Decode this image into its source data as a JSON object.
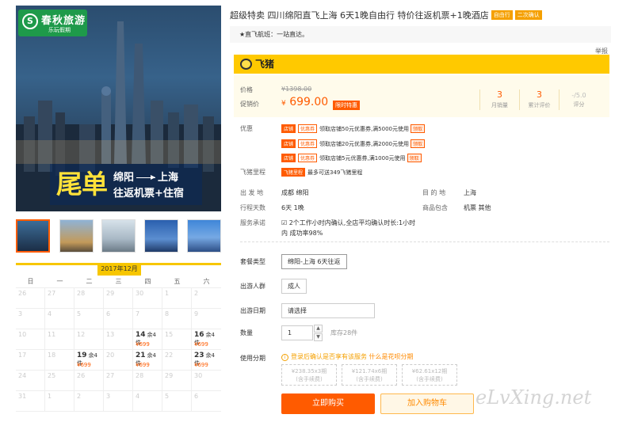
{
  "hero": {
    "logo_mark": "S",
    "logo_name": "春秋旅游",
    "logo_sub": "乐玩假期",
    "banner_big": "尾单",
    "banner_from": "绵阳",
    "banner_to": "上海",
    "banner_line2": "往返机票+住宿"
  },
  "product": {
    "title": "超级特卖 四川绵阳直飞上海 6天1晚自由行 特价往返机票+1晚酒店",
    "tags": [
      "自由行",
      "二次确认"
    ],
    "direct_flight_note": "★直飞航班：一站直达。",
    "report_link": "举报"
  },
  "brand": {
    "name": "飞猪"
  },
  "pricing": {
    "original_label": "价格",
    "original_price": "¥1398.00",
    "promo_label": "促销价",
    "currency": "¥",
    "promo_price": "699.00",
    "badge": "限时特惠",
    "stats": [
      {
        "value": "3",
        "label": "月销量"
      },
      {
        "value": "3",
        "label": "累计评价"
      },
      {
        "value": "-/5.0",
        "label": "评分"
      }
    ]
  },
  "promotions": {
    "label": "优惠",
    "items": [
      {
        "tag1": "店铺",
        "tag2": "优惠券",
        "text": "领取店铺50元优惠券,满5000元使用",
        "action": "领取"
      },
      {
        "tag1": "店铺",
        "tag2": "优惠券",
        "text": "领取店铺20元优惠券,满2000元使用",
        "action": "领取"
      },
      {
        "tag1": "店铺",
        "tag2": "优惠券",
        "text": "领取店铺5元优惠券,满1000元使用",
        "action": "领取"
      }
    ],
    "mileage_label": "飞猪里程",
    "mileage_tag": "飞猪里程",
    "mileage_text": "最多可送349飞猪里程"
  },
  "info": {
    "departure_label": "出 发 地",
    "departure": "成都  绵阳",
    "destination_label": "目 的 地",
    "destination": "上海",
    "days_label": "行程天数",
    "days": "6天  1晚",
    "includes_label": "商品包含",
    "includes": "机票  其他",
    "service_label": "服务承诺",
    "service_line1": "2个工作小时内确认,全店平均确认时长:1小时",
    "service_line2": "内 成功率98%"
  },
  "options": {
    "package_label": "套餐类型",
    "package_value": "绵阳-上海 6天往返",
    "people_label": "出游人群",
    "people_value": "成人",
    "date_label": "出游日期",
    "date_placeholder": "请选择",
    "qty_label": "数量",
    "qty_value": "1",
    "qty_up": "▲",
    "qty_down": "▼",
    "stock": "库存28件",
    "installment_label": "使用分期",
    "installment_note_a": "登录后确认是否享有该服务 ",
    "installment_note_link": "什么是花呗分期",
    "installments": [
      {
        "line1": "¥238.35x3期",
        "line2": "(含手续费)"
      },
      {
        "line1": "¥121.74x6期",
        "line2": "(含手续费)"
      },
      {
        "line1": "¥62.61x12期",
        "line2": "(含手续费)"
      }
    ],
    "buy_now": "立即购买",
    "add_to_cart": "加入购物车"
  },
  "calendar": {
    "month": "2017年12月",
    "weekdays": [
      "日",
      "一",
      "二",
      "三",
      "四",
      "五",
      "六"
    ],
    "cells": [
      {
        "d": "26"
      },
      {
        "d": "27"
      },
      {
        "d": "28"
      },
      {
        "d": "29"
      },
      {
        "d": "30"
      },
      {
        "d": "1"
      },
      {
        "d": "2"
      },
      {
        "d": "3"
      },
      {
        "d": "4"
      },
      {
        "d": "5"
      },
      {
        "d": "6"
      },
      {
        "d": "7"
      },
      {
        "d": "8"
      },
      {
        "d": "9"
      },
      {
        "d": "10"
      },
      {
        "d": "11"
      },
      {
        "d": "12"
      },
      {
        "d": "13"
      },
      {
        "d": "14",
        "stock": "余4件",
        "price": "¥699"
      },
      {
        "d": "15"
      },
      {
        "d": "16",
        "stock": "余4件",
        "price": "¥699"
      },
      {
        "d": "17"
      },
      {
        "d": "18"
      },
      {
        "d": "19",
        "stock": "余4件",
        "price": "¥699"
      },
      {
        "d": "20"
      },
      {
        "d": "21",
        "stock": "余4件",
        "price": "¥699"
      },
      {
        "d": "22"
      },
      {
        "d": "23",
        "stock": "余4件",
        "price": "¥699"
      },
      {
        "d": "24"
      },
      {
        "d": "25"
      },
      {
        "d": "26"
      },
      {
        "d": "27"
      },
      {
        "d": "28"
      },
      {
        "d": "29"
      },
      {
        "d": "30"
      },
      {
        "d": "31"
      },
      {
        "d": "1"
      },
      {
        "d": "2"
      },
      {
        "d": "3"
      },
      {
        "d": "4"
      },
      {
        "d": "5"
      },
      {
        "d": "6"
      }
    ]
  },
  "watermark": "eLvXing.net"
}
